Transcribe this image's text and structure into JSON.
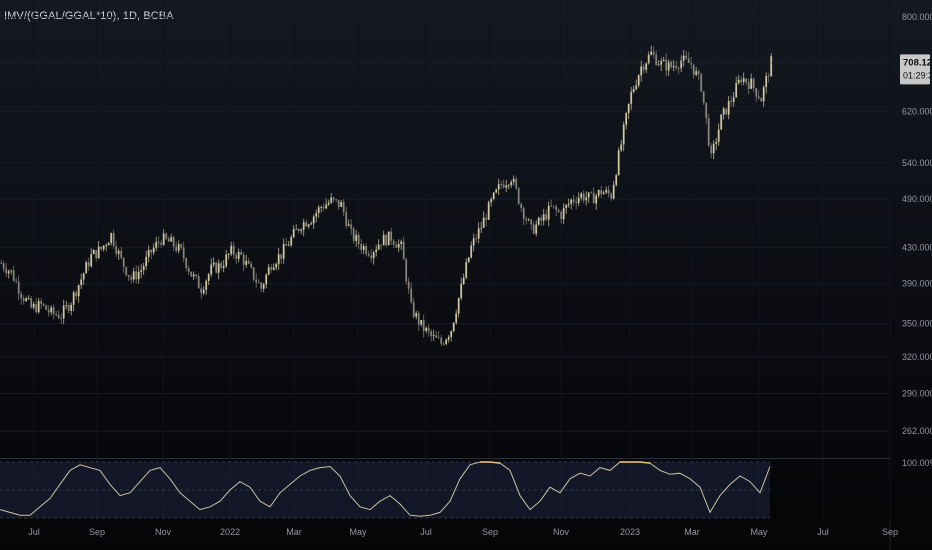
{
  "chart_data": {
    "type": "candlestick",
    "title": "IMV/(GGAL/GGAL*10), 1D, BCBA",
    "price_axis": {
      "scale": "log",
      "ticks": [
        "800.000",
        "620.000",
        "540.000",
        "490.000",
        "430.000",
        "390.000",
        "350.000",
        "320.000",
        "290.000",
        "262.000"
      ],
      "range": [
        245,
        820
      ]
    },
    "last_price": "708.121",
    "countdown": "01:29:39",
    "x_axis": {
      "ticks": [
        "Jul",
        "Sep",
        "Nov",
        "2022",
        "Mar",
        "May",
        "Jul",
        "Sep",
        "Nov",
        "2023",
        "Mar",
        "May",
        "Jul",
        "Sep"
      ]
    },
    "series": [
      {
        "name": "close",
        "points": [
          [
            0,
            412
          ],
          [
            10,
            402
          ],
          [
            20,
            380
          ],
          [
            30,
            365
          ],
          [
            40,
            368
          ],
          [
            50,
            360
          ],
          [
            60,
            358
          ],
          [
            70,
            372
          ],
          [
            80,
            395
          ],
          [
            90,
            420
          ],
          [
            100,
            428
          ],
          [
            110,
            445
          ],
          [
            120,
            415
          ],
          [
            130,
            395
          ],
          [
            140,
            405
          ],
          [
            150,
            425
          ],
          [
            160,
            440
          ],
          [
            170,
            435
          ],
          [
            180,
            425
          ],
          [
            190,
            400
          ],
          [
            200,
            385
          ],
          [
            210,
            405
          ],
          [
            220,
            410
          ],
          [
            230,
            425
          ],
          [
            240,
            420
          ],
          [
            250,
            402
          ],
          [
            260,
            385
          ],
          [
            270,
            412
          ],
          [
            280,
            422
          ],
          [
            290,
            440
          ],
          [
            300,
            458
          ],
          [
            310,
            465
          ],
          [
            320,
            480
          ],
          [
            330,
            487
          ],
          [
            340,
            482
          ],
          [
            350,
            445
          ],
          [
            360,
            432
          ],
          [
            370,
            425
          ],
          [
            380,
            438
          ],
          [
            390,
            442
          ],
          [
            400,
            430
          ],
          [
            410,
            365
          ],
          [
            420,
            348
          ],
          [
            430,
            338
          ],
          [
            440,
            332
          ],
          [
            450,
            345
          ],
          [
            460,
            385
          ],
          [
            470,
            430
          ],
          [
            480,
            455
          ],
          [
            490,
            485
          ],
          [
            500,
            510
          ],
          [
            510,
            520
          ],
          [
            520,
            480
          ],
          [
            530,
            450
          ],
          [
            540,
            462
          ],
          [
            550,
            478
          ],
          [
            560,
            470
          ],
          [
            570,
            488
          ],
          [
            580,
            495
          ],
          [
            590,
            490
          ],
          [
            600,
            500
          ],
          [
            610,
            495
          ],
          [
            620,
            568
          ],
          [
            630,
            650
          ],
          [
            640,
            700
          ],
          [
            650,
            725
          ],
          [
            660,
            705
          ],
          [
            670,
            700
          ],
          [
            680,
            712
          ],
          [
            690,
            705
          ],
          [
            700,
            665
          ],
          [
            710,
            545
          ],
          [
            720,
            608
          ],
          [
            730,
            640
          ],
          [
            740,
            680
          ],
          [
            750,
            668
          ],
          [
            760,
            642
          ],
          [
            770,
            708
          ]
        ]
      }
    ],
    "oscillator": {
      "ticks": [
        "100.00%"
      ],
      "upper_band": 100,
      "middle_band": 50,
      "lower_band": 0,
      "x_step": 10,
      "values": [
        15,
        10,
        5,
        5,
        20,
        35,
        60,
        85,
        95,
        90,
        85,
        60,
        40,
        45,
        65,
        85,
        90,
        70,
        45,
        30,
        15,
        20,
        30,
        50,
        65,
        55,
        30,
        20,
        45,
        60,
        75,
        85,
        90,
        92,
        75,
        40,
        20,
        15,
        30,
        40,
        25,
        5,
        3,
        5,
        10,
        30,
        70,
        95,
        100,
        100,
        98,
        85,
        40,
        15,
        30,
        55,
        45,
        70,
        80,
        75,
        90,
        85,
        100,
        100,
        100,
        98,
        85,
        78,
        80,
        70,
        55,
        10,
        40,
        60,
        75,
        65,
        45,
        92
      ]
    },
    "colors": {
      "candle_up": "#d8cfa8",
      "candle_down": "#8c8a80",
      "oscillator_line": "#c9c2a4",
      "oscillator_high": "#e9c07a",
      "band_fill": "#1d2440",
      "last_price_tag": "#c8c8c8"
    }
  }
}
